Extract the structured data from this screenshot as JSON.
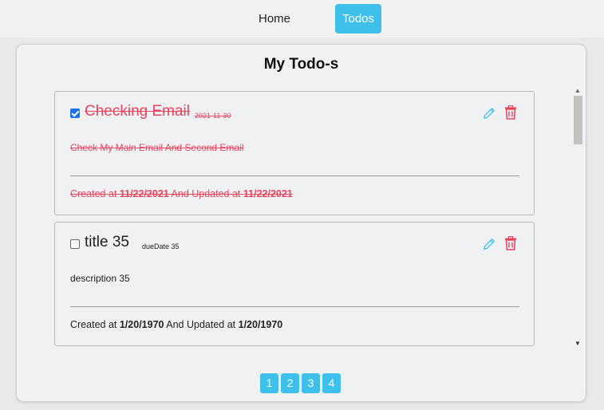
{
  "nav": {
    "home": "Home",
    "todos": "Todos"
  },
  "page": {
    "title": "My Todo-s"
  },
  "todos": [
    {
      "completed": true,
      "title": "Checking Email",
      "due_date": "2021-11-30",
      "description": "Check My Main Email And Second Email",
      "created_prefix": "Created at",
      "created": "11/22/2021",
      "updated_prefix": "And Updated at",
      "updated": "11/22/2021"
    },
    {
      "completed": false,
      "title": "title 35",
      "due_date": "dueDate 35",
      "description": "description 35",
      "created_prefix": "Created at",
      "created": "1/20/1970",
      "updated_prefix": "And Updated at",
      "updated": "1/20/1970"
    }
  ],
  "icons": {
    "edit": "pencil-icon",
    "delete": "trash-icon"
  },
  "colors": {
    "accent": "#3fc0ea",
    "completed_text": "#e8455f",
    "delete": "#e8455f",
    "checkbox_checked": "#1a73e8"
  },
  "pagination": {
    "pages": [
      "1",
      "2",
      "3",
      "4"
    ]
  }
}
